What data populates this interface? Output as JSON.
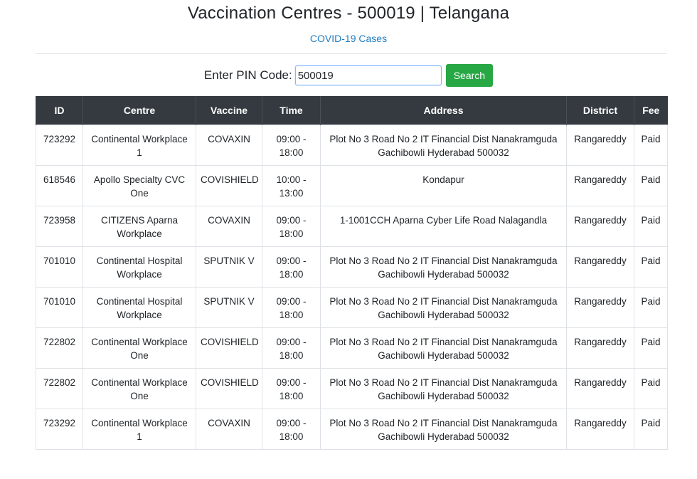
{
  "page": {
    "title": "Vaccination Centres - 500019 | Telangana",
    "cases_link": "COVID-19 Cases"
  },
  "search": {
    "label": "Enter PIN Code:",
    "value": "500019",
    "button_label": "Search"
  },
  "table": {
    "headers": [
      "ID",
      "Centre",
      "Vaccine",
      "Time",
      "Address",
      "District",
      "Fee"
    ],
    "rows": [
      {
        "id": "723292",
        "centre": "Continental Workplace 1",
        "vaccine": "COVAXIN",
        "time": "09:00 - 18:00",
        "address": "Plot No 3 Road No 2 IT Financial Dist Nanakramguda Gachibowli Hyderabad 500032",
        "district": "Rangareddy",
        "fee": "Paid"
      },
      {
        "id": "618546",
        "centre": "Apollo Specialty CVC One",
        "vaccine": "COVISHIELD",
        "time": "10:00 - 13:00",
        "address": "Kondapur",
        "district": "Rangareddy",
        "fee": "Paid"
      },
      {
        "id": "723958",
        "centre": "CITIZENS Aparna Workplace",
        "vaccine": "COVAXIN",
        "time": "09:00 - 18:00",
        "address": "1-1001CCH Aparna Cyber Life Road Nalagandla",
        "district": "Rangareddy",
        "fee": "Paid"
      },
      {
        "id": "701010",
        "centre": "Continental Hospital Workplace",
        "vaccine": "SPUTNIK V",
        "time": "09:00 - 18:00",
        "address": "Plot No 3 Road No 2 IT Financial Dist Nanakramguda Gachibowli Hyderabad 500032",
        "district": "Rangareddy",
        "fee": "Paid"
      },
      {
        "id": "701010",
        "centre": "Continental Hospital Workplace",
        "vaccine": "SPUTNIK V",
        "time": "09:00 - 18:00",
        "address": "Plot No 3 Road No 2 IT Financial Dist Nanakramguda Gachibowli Hyderabad 500032",
        "district": "Rangareddy",
        "fee": "Paid"
      },
      {
        "id": "722802",
        "centre": "Continental Workplace One",
        "vaccine": "COVISHIELD",
        "time": "09:00 - 18:00",
        "address": "Plot No 3 Road No 2 IT Financial Dist Nanakramguda Gachibowli Hyderabad 500032",
        "district": "Rangareddy",
        "fee": "Paid"
      },
      {
        "id": "722802",
        "centre": "Continental Workplace One",
        "vaccine": "COVISHIELD",
        "time": "09:00 - 18:00",
        "address": "Plot No 3 Road No 2 IT Financial Dist Nanakramguda Gachibowli Hyderabad 500032",
        "district": "Rangareddy",
        "fee": "Paid"
      },
      {
        "id": "723292",
        "centre": "Continental Workplace 1",
        "vaccine": "COVAXIN",
        "time": "09:00 - 18:00",
        "address": "Plot No 3 Road No 2 IT Financial Dist Nanakramguda Gachibowli Hyderabad 500032",
        "district": "Rangareddy",
        "fee": "Paid"
      }
    ]
  },
  "colors": {
    "header_bg": "#343a40",
    "search_button": "#28a745",
    "link": "#1f7bc0",
    "covaxin": "#17a2d8",
    "covishield": "#1e7e1e",
    "sputnik": "#1a1ab0"
  }
}
